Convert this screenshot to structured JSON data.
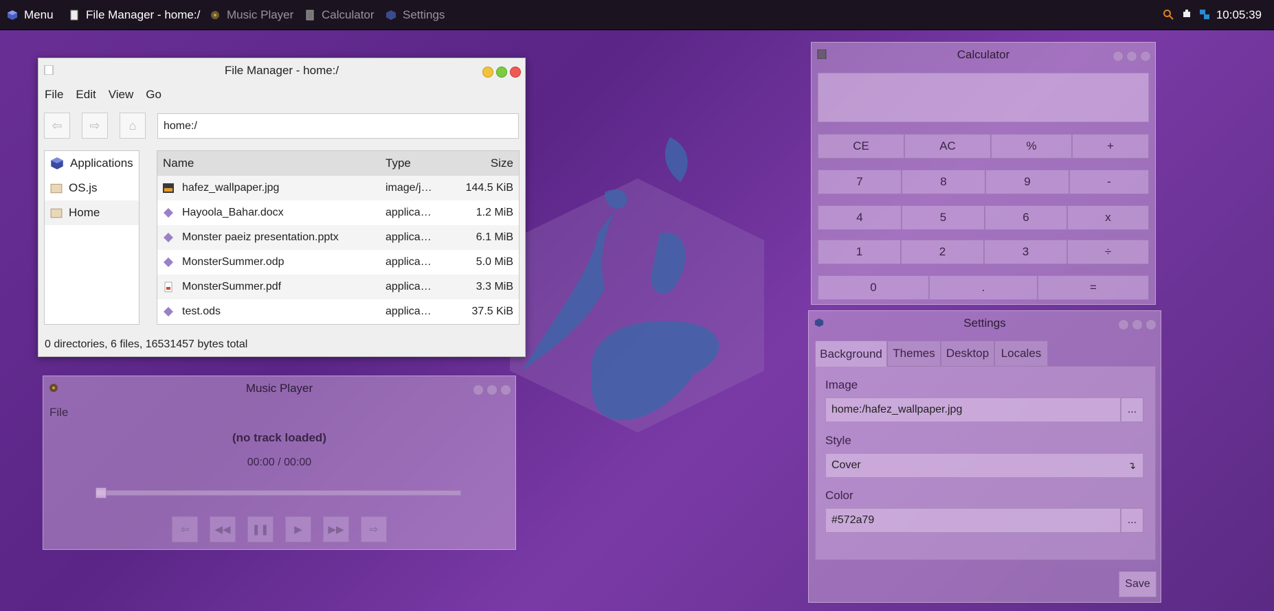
{
  "panel": {
    "menu_label": "Menu",
    "tasks": [
      {
        "label": "File Manager - home:/",
        "icon": "document-icon"
      },
      {
        "label": "Music Player",
        "icon": "music-icon"
      },
      {
        "label": "Calculator",
        "icon": "calculator-icon"
      },
      {
        "label": "Settings",
        "icon": "settings-icon"
      }
    ],
    "clock": "10:05:39"
  },
  "file_manager": {
    "title": "File Manager - home:/",
    "menu": [
      "File",
      "Edit",
      "View",
      "Go"
    ],
    "path": "home:/",
    "sidebar": [
      "Applications",
      "OS.js",
      "Home"
    ],
    "columns": {
      "name": "Name",
      "type": "Type",
      "size": "Size"
    },
    "files": [
      {
        "name": "hafez_wallpaper.jpg",
        "type": "image/j…",
        "size": "144.5 KiB",
        "icon": "image-file-icon"
      },
      {
        "name": "Hayoola_Bahar.docx",
        "type": "applica…",
        "size": "1.2 MiB",
        "icon": "document-file-icon"
      },
      {
        "name": "Monster paeiz presentation.pptx",
        "type": "applica…",
        "size": "6.1 MiB",
        "icon": "document-file-icon"
      },
      {
        "name": "MonsterSummer.odp",
        "type": "applica…",
        "size": "5.0 MiB",
        "icon": "document-file-icon"
      },
      {
        "name": "MonsterSummer.pdf",
        "type": "applica…",
        "size": "3.3 MiB",
        "icon": "pdf-file-icon"
      },
      {
        "name": "test.ods",
        "type": "applica…",
        "size": "37.5 KiB",
        "icon": "document-file-icon"
      }
    ],
    "status": "0 directories, 6 files, 16531457 bytes total"
  },
  "music_player": {
    "title": "Music Player",
    "menu": [
      "File"
    ],
    "track": "(no track loaded)",
    "time": "00:00 / 00:00",
    "progress": 0
  },
  "calculator": {
    "title": "Calculator",
    "display": "",
    "rows": [
      [
        "CE",
        "AC",
        "%",
        "+"
      ],
      [
        "7",
        "8",
        "9",
        "-"
      ],
      [
        "4",
        "5",
        "6",
        "x"
      ],
      [
        "1",
        "2",
        "3",
        "÷"
      ],
      [
        "0",
        ".",
        "="
      ]
    ]
  },
  "settings": {
    "title": "Settings",
    "tabs": [
      "Background",
      "Themes",
      "Desktop",
      "Locales"
    ],
    "image_label": "Image",
    "image_value": "home:/hafez_wallpaper.jpg",
    "browse_label": "...",
    "style_label": "Style",
    "style_value": "Cover",
    "color_label": "Color",
    "color_value": "#572a79",
    "save_label": "Save"
  }
}
